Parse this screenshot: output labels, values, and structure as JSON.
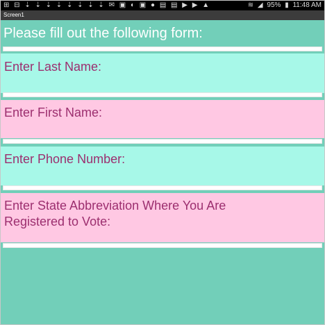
{
  "status_bar": {
    "notification_icons": "⊞ ⊟ ⇣ ⇣ ⇣ ⇣ ⇣ ⇣ ⇣ ⇣ ✉ ▣ ◐ ▣ ● ▤ ▤ ▶ ▶ ▲",
    "battery_percent": "95%",
    "time": "11:48 AM"
  },
  "app": {
    "screen_title": "Screen1"
  },
  "form": {
    "heading": "Please fill out the following form:",
    "fields": [
      {
        "label": "Enter Last Name:",
        "value": ""
      },
      {
        "label": "Enter First Name:",
        "value": ""
      },
      {
        "label": "Enter Phone Number:",
        "value": ""
      },
      {
        "label": "Enter State Abbreviation Where You Are Registered to Vote:",
        "value": ""
      }
    ]
  },
  "colors": {
    "background": "#72cfb9",
    "panel_cyan": "#a7f8e8",
    "panel_pink": "#ffc8e3",
    "label_text": "#9c2f6f"
  }
}
